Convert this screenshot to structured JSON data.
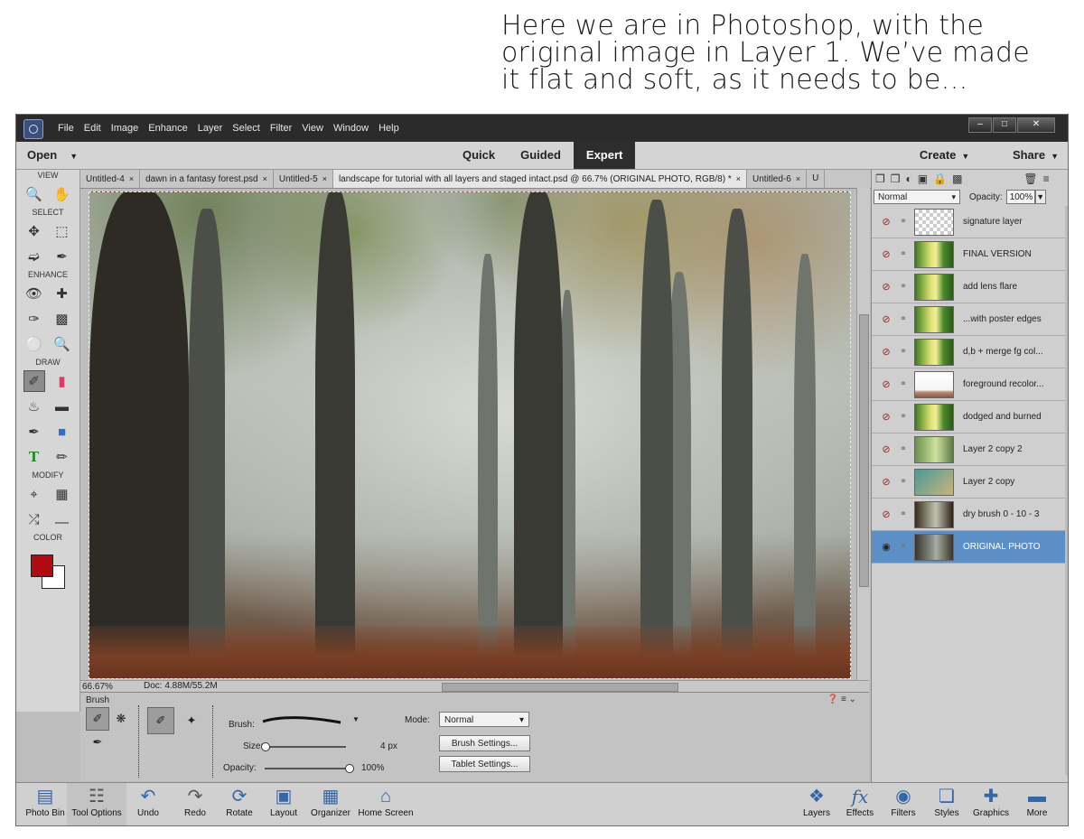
{
  "caption": {
    "lines": [
      "Here we are in Photoshop, with the",
      "original image in Layer 1. We’ve made",
      "it flat and soft, as it needs to be…"
    ]
  },
  "menu": [
    "File",
    "Edit",
    "Image",
    "Enhance",
    "Layer",
    "Select",
    "Filter",
    "View",
    "Window",
    "Help"
  ],
  "modebar": {
    "open": "Open",
    "modes": [
      "Quick",
      "Guided",
      "Expert"
    ],
    "active_mode": "Expert",
    "create": "Create",
    "share": "Share"
  },
  "toolbox": {
    "sections": [
      "VIEW",
      "SELECT",
      "ENHANCE",
      "DRAW",
      "MODIFY",
      "COLOR"
    ],
    "foreground_color": "#b00b10",
    "background_color": "#ffffff"
  },
  "tabs": [
    "Untitled-4",
    "dawn in a fantasy forest.psd",
    "Untitled-5",
    "landscape for tutorial with all layers and staged intact.psd @ 66.7% (ORIGINAL PHOTO, RGB/8) *",
    "Untitled-6",
    "U"
  ],
  "status": {
    "zoom": "66.67%",
    "doc": "Doc: 4.88M/55.2M"
  },
  "tool_options": {
    "title": "Brush",
    "brush_label": "Brush:",
    "size_label": "Size:",
    "size_value": "4 px",
    "opacity_label": "Opacity:",
    "opacity_value": "100%",
    "mode_label": "Mode:",
    "mode_value": "Normal",
    "brush_settings": "Brush Settings...",
    "tablet_settings": "Tablet Settings..."
  },
  "layers_panel": {
    "blend_mode": "Normal",
    "opacity_label": "Opacity:",
    "opacity_value": "100%",
    "layers": [
      {
        "name": "signature layer",
        "thumb": "checker",
        "selected": false
      },
      {
        "name": "FINAL VERSION",
        "thumb": "bright",
        "selected": false
      },
      {
        "name": "add lens flare",
        "thumb": "bright",
        "selected": false
      },
      {
        "name": "...with poster edges",
        "thumb": "bright",
        "selected": false
      },
      {
        "name": "d,b + merge fg col...",
        "thumb": "bright",
        "selected": false
      },
      {
        "name": "foreground recolor...",
        "thumb": "fg",
        "selected": false
      },
      {
        "name": "dodged and burned",
        "thumb": "bright",
        "selected": false
      },
      {
        "name": "Layer 2 copy 2",
        "thumb": "teal",
        "selected": false
      },
      {
        "name": "Layer 2 copy",
        "thumb": "grad",
        "selected": false
      },
      {
        "name": "dry brush 0 - 10 - 3",
        "thumb": "dry",
        "selected": false
      },
      {
        "name": "ORIGINAL PHOTO",
        "thumb": "orig",
        "selected": true
      }
    ]
  },
  "bottombar": {
    "left": [
      "Photo Bin",
      "Tool Options",
      "Undo",
      "Redo",
      "Rotate",
      "Layout",
      "Organizer",
      "Home Screen"
    ],
    "right": [
      "Layers",
      "Effects",
      "Filters",
      "Styles",
      "Graphics",
      "More"
    ]
  }
}
